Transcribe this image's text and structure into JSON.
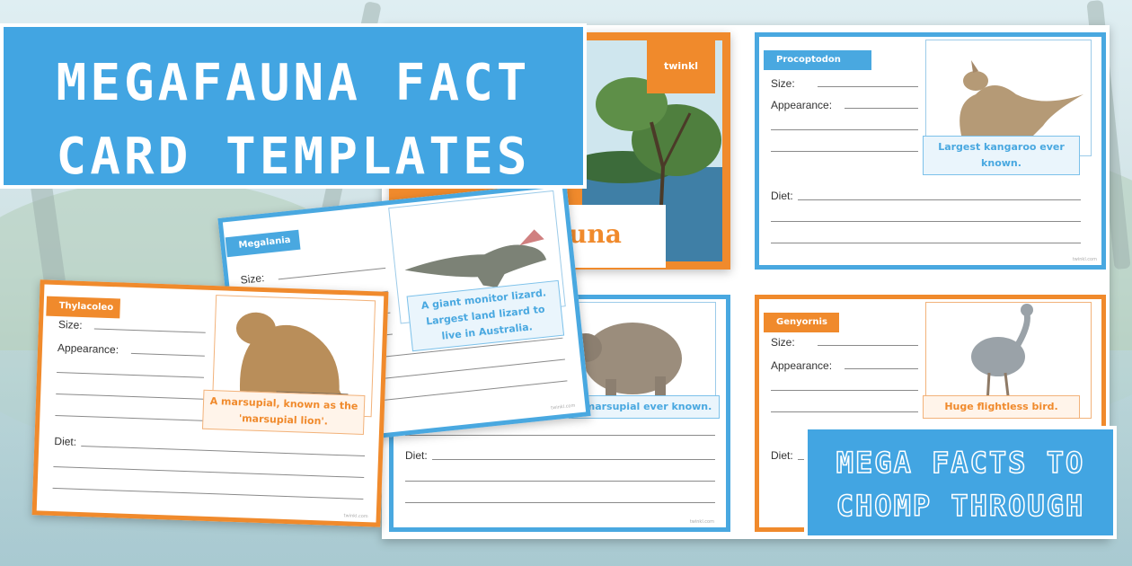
{
  "banner": {
    "line1": "MEGAFAUNA FACT",
    "line2": "CARD TEMPLATES"
  },
  "tagline": {
    "line1": "MEGA FACTS TO",
    "line2": "CHOMP THROUGH"
  },
  "cover": {
    "title_fragment": "una",
    "logo": "twinkl"
  },
  "labels": {
    "size": "Size:",
    "appearance": "Appearance:",
    "diet": "Diet:"
  },
  "cards": {
    "procoptodon": {
      "name": "Procoptodon",
      "caption": "Largest kangaroo ever known."
    },
    "megalania": {
      "name": "Megalania",
      "caption": "A giant monitor lizard. Largest land lizard to live in Australia."
    },
    "thylacoleo": {
      "name": "Thylacoleo",
      "caption": "A marsupial, known as the 'marsupial lion'."
    },
    "diprotodon": {
      "caption_fragment": "t marsupial ever known."
    },
    "genyornis": {
      "name": "Genyornis",
      "caption": "Huge flightless bird."
    }
  },
  "watermark": "twinkl.com",
  "colors": {
    "blue": "#49a8e0",
    "orange": "#f08a2c",
    "banner": "#42a5e2"
  }
}
